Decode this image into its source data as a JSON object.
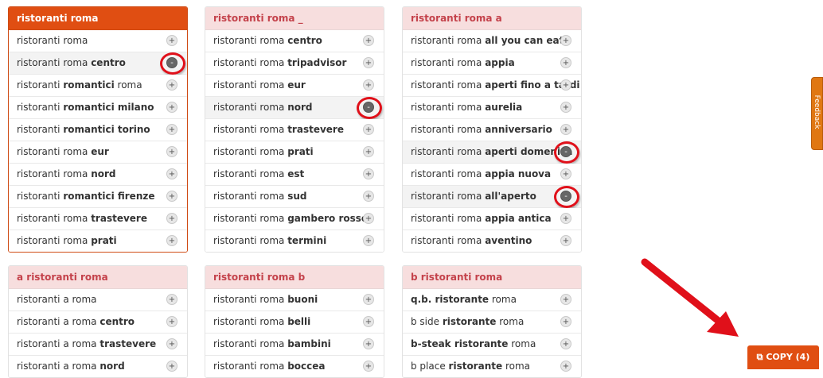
{
  "cards": [
    {
      "title": "ristoranti roma",
      "items": [
        {
          "pre": "ristoranti roma",
          "bold": "",
          "post": "",
          "sign": "+"
        },
        {
          "pre": "ristoranti roma ",
          "bold": "centro",
          "post": "",
          "sign": "-"
        },
        {
          "pre": "ristoranti ",
          "bold": "romantici",
          "post": " roma",
          "sign": "+"
        },
        {
          "pre": "ristoranti ",
          "bold": "romantici milano",
          "post": "",
          "sign": "+"
        },
        {
          "pre": "ristoranti ",
          "bold": "romantici torino",
          "post": "",
          "sign": "+"
        },
        {
          "pre": "ristoranti roma ",
          "bold": "eur",
          "post": "",
          "sign": "+"
        },
        {
          "pre": "ristoranti roma ",
          "bold": "nord",
          "post": "",
          "sign": "+"
        },
        {
          "pre": "ristoranti ",
          "bold": "romantici firenze",
          "post": "",
          "sign": "+"
        },
        {
          "pre": "ristoranti roma ",
          "bold": "trastevere",
          "post": "",
          "sign": "+"
        },
        {
          "pre": "ristoranti roma ",
          "bold": "prati",
          "post": "",
          "sign": "+"
        }
      ]
    },
    {
      "title": "ristoranti roma _",
      "items": [
        {
          "pre": "ristoranti roma ",
          "bold": "centro",
          "post": "",
          "sign": "+"
        },
        {
          "pre": "ristoranti roma ",
          "bold": "tripadvisor",
          "post": "",
          "sign": "+"
        },
        {
          "pre": "ristoranti roma ",
          "bold": "eur",
          "post": "",
          "sign": "+"
        },
        {
          "pre": "ristoranti roma ",
          "bold": "nord",
          "post": "",
          "sign": "-"
        },
        {
          "pre": "ristoranti roma ",
          "bold": "trastevere",
          "post": "",
          "sign": "+"
        },
        {
          "pre": "ristoranti roma ",
          "bold": "prati",
          "post": "",
          "sign": "+"
        },
        {
          "pre": "ristoranti roma ",
          "bold": "est",
          "post": "",
          "sign": "+"
        },
        {
          "pre": "ristoranti roma ",
          "bold": "sud",
          "post": "",
          "sign": "+"
        },
        {
          "pre": "ristoranti roma ",
          "bold": "gambero rosso",
          "post": "",
          "sign": "+"
        },
        {
          "pre": "ristoranti roma ",
          "bold": "termini",
          "post": "",
          "sign": "+"
        }
      ]
    },
    {
      "title": "ristoranti roma a",
      "items": [
        {
          "pre": "ristoranti roma ",
          "bold": "all you can eat",
          "post": "",
          "sign": "+"
        },
        {
          "pre": "ristoranti roma ",
          "bold": "appia",
          "post": "",
          "sign": "+"
        },
        {
          "pre": "ristoranti roma ",
          "bold": "aperti fino a tardi",
          "post": "",
          "sign": "+"
        },
        {
          "pre": "ristoranti roma ",
          "bold": "aurelia",
          "post": "",
          "sign": "+"
        },
        {
          "pre": "ristoranti roma ",
          "bold": "anniversario",
          "post": "",
          "sign": "+"
        },
        {
          "pre": "ristoranti roma ",
          "bold": "aperti domenica",
          "post": "",
          "sign": "-"
        },
        {
          "pre": "ristoranti roma ",
          "bold": "appia nuova",
          "post": "",
          "sign": "+"
        },
        {
          "pre": "ristoranti roma ",
          "bold": "all'aperto",
          "post": "",
          "sign": "-"
        },
        {
          "pre": "ristoranti roma ",
          "bold": "appia antica",
          "post": "",
          "sign": "+"
        },
        {
          "pre": "ristoranti roma ",
          "bold": "aventino",
          "post": "",
          "sign": "+"
        }
      ]
    },
    {
      "title": "a ristoranti roma",
      "items": [
        {
          "pre": "ristoranti a roma",
          "bold": "",
          "post": "",
          "sign": "+"
        },
        {
          "pre": "ristoranti a roma ",
          "bold": "centro",
          "post": "",
          "sign": "+"
        },
        {
          "pre": "ristoranti a roma ",
          "bold": "trastevere",
          "post": "",
          "sign": "+"
        },
        {
          "pre": "ristoranti a roma ",
          "bold": "nord",
          "post": "",
          "sign": "+"
        }
      ]
    },
    {
      "title": "ristoranti roma b",
      "items": [
        {
          "pre": "ristoranti roma ",
          "bold": "buoni",
          "post": "",
          "sign": "+"
        },
        {
          "pre": "ristoranti roma ",
          "bold": "belli",
          "post": "",
          "sign": "+"
        },
        {
          "pre": "ristoranti roma ",
          "bold": "bambini",
          "post": "",
          "sign": "+"
        },
        {
          "pre": "ristoranti roma ",
          "bold": "boccea",
          "post": "",
          "sign": "+"
        }
      ]
    },
    {
      "title": "b ristoranti roma",
      "items": [
        {
          "pre": "",
          "bold": "q.b. ristorante",
          "post": " roma",
          "sign": "+"
        },
        {
          "pre": "b side ",
          "bold": "ristorante",
          "post": " roma",
          "sign": "+"
        },
        {
          "pre": "",
          "bold": "b-steak ristorante",
          "post": " roma",
          "sign": "+"
        },
        {
          "pre": "b place ",
          "bold": "ristorante",
          "post": " roma",
          "sign": "+"
        }
      ]
    }
  ],
  "feedback_label": "Feedback",
  "copy_button": {
    "icon": "⧉",
    "label": "COPY",
    "count": "(4)"
  },
  "colors": {
    "accent": "#e04e12",
    "header_bg": "#f7dede",
    "header_text": "#c4424b",
    "annotation": "#e0101a"
  }
}
